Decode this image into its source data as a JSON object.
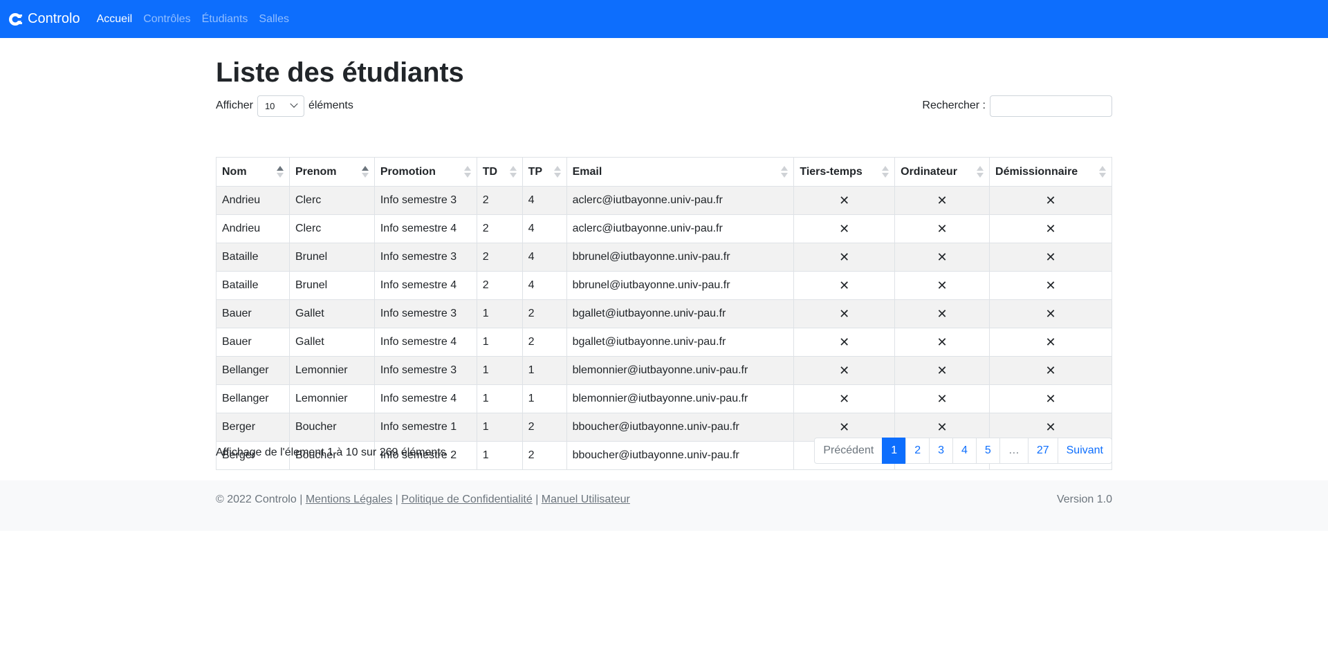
{
  "navbar": {
    "brand": "Controlo",
    "links": [
      "Accueil",
      "Contrôles",
      "Étudiants",
      "Salles"
    ],
    "bg": "#0d6efd"
  },
  "page": {
    "title": "Liste des étudiants",
    "show_label": "Afficher",
    "show_value": "10",
    "show_suffix": "éléments",
    "search_label": "Rechercher :",
    "search_value": ""
  },
  "table": {
    "headers": [
      "Nom",
      "Prenom",
      "Promotion",
      "TD",
      "TP",
      "Email",
      "Tiers-temps",
      "Ordinateur",
      "Démissionnaire"
    ],
    "rows": [
      [
        "Andrieu",
        "Clerc",
        "Info semestre 3",
        "2",
        "4",
        "aclerc@iutbayonne.univ-pau.fr",
        "✕",
        "✕",
        "✕"
      ],
      [
        "Andrieu",
        "Clerc",
        "Info semestre 4",
        "2",
        "4",
        "aclerc@iutbayonne.univ-pau.fr",
        "✕",
        "✕",
        "✕"
      ],
      [
        "Bataille",
        "Brunel",
        "Info semestre 3",
        "2",
        "4",
        "bbrunel@iutbayonne.univ-pau.fr",
        "✕",
        "✕",
        "✕"
      ],
      [
        "Bataille",
        "Brunel",
        "Info semestre 4",
        "2",
        "4",
        "bbrunel@iutbayonne.univ-pau.fr",
        "✕",
        "✕",
        "✕"
      ],
      [
        "Bauer",
        "Gallet",
        "Info semestre 3",
        "1",
        "2",
        "bgallet@iutbayonne.univ-pau.fr",
        "✕",
        "✕",
        "✕"
      ],
      [
        "Bauer",
        "Gallet",
        "Info semestre 4",
        "1",
        "2",
        "bgallet@iutbayonne.univ-pau.fr",
        "✕",
        "✕",
        "✕"
      ],
      [
        "Bellanger",
        "Lemonnier",
        "Info semestre 3",
        "1",
        "1",
        "blemonnier@iutbayonne.univ-pau.fr",
        "✕",
        "✕",
        "✕"
      ],
      [
        "Bellanger",
        "Lemonnier",
        "Info semestre 4",
        "1",
        "1",
        "blemonnier@iutbayonne.univ-pau.fr",
        "✕",
        "✕",
        "✕"
      ],
      [
        "Berger",
        "Boucher",
        "Info semestre 1",
        "1",
        "2",
        "bboucher@iutbayonne.univ-pau.fr",
        "✕",
        "✕",
        "✕"
      ],
      [
        "Berger",
        "Boucher",
        "Info semestre 2",
        "1",
        "2",
        "bboucher@iutbayonne.univ-pau.fr",
        "✕",
        "✕",
        "✕"
      ]
    ]
  },
  "info": "Affichage de l'élement 1 à 10 sur 269 éléments",
  "pagination": [
    "Précédent",
    "1",
    "2",
    "3",
    "4",
    "5",
    "…",
    "27",
    "Suivant"
  ],
  "footer": {
    "copyright": "© 2022 Controlo |",
    "links": [
      "Mentions Légales",
      "Politique de Confidentialité",
      "Manuel Utilisateur"
    ],
    "version": "Version 1.0"
  }
}
